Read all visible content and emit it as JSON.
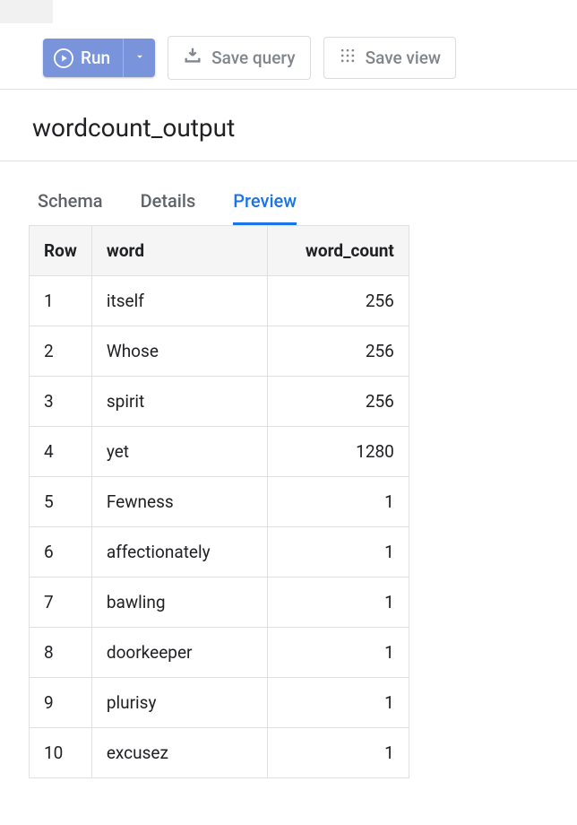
{
  "toolbar": {
    "run_label": "Run",
    "save_query_label": "Save query",
    "save_view_label": "Save view"
  },
  "title": "wordcount_output",
  "tabs": [
    {
      "label": "Schema",
      "active": false
    },
    {
      "label": "Details",
      "active": false
    },
    {
      "label": "Preview",
      "active": true
    }
  ],
  "table": {
    "headers": {
      "row": "Row",
      "word": "word",
      "word_count": "word_count"
    },
    "rows": [
      {
        "row": "1",
        "word": "itself",
        "word_count": "256"
      },
      {
        "row": "2",
        "word": "Whose",
        "word_count": "256"
      },
      {
        "row": "3",
        "word": "spirit",
        "word_count": "256"
      },
      {
        "row": "4",
        "word": "yet",
        "word_count": "1280"
      },
      {
        "row": "5",
        "word": "Fewness",
        "word_count": "1"
      },
      {
        "row": "6",
        "word": "affectionately",
        "word_count": "1"
      },
      {
        "row": "7",
        "word": "bawling",
        "word_count": "1"
      },
      {
        "row": "8",
        "word": "doorkeeper",
        "word_count": "1"
      },
      {
        "row": "9",
        "word": "plurisy",
        "word_count": "1"
      },
      {
        "row": "10",
        "word": "excusez",
        "word_count": "1"
      }
    ]
  }
}
